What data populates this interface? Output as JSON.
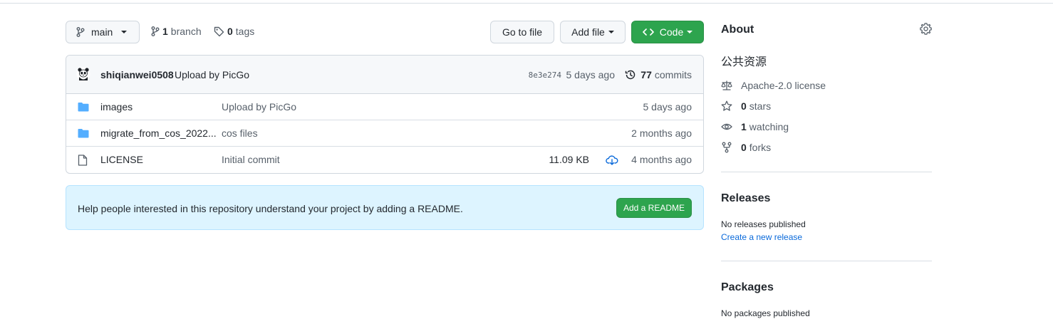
{
  "branch_bar": {
    "branch_name": "main",
    "branch_count": "1",
    "branch_label": "branch",
    "tag_count": "0",
    "tag_label": "tags"
  },
  "actions": {
    "go_to_file": "Go to file",
    "add_file": "Add file",
    "code": "Code"
  },
  "commit": {
    "author": "shiqianwei0508",
    "message": "Upload by PicGo",
    "sha": "8e3e274",
    "time": "5 days ago",
    "count": "77",
    "count_label": "commits"
  },
  "files": [
    {
      "type": "folder",
      "name": "images",
      "message": "Upload by PicGo",
      "size": "",
      "time": "5 days ago"
    },
    {
      "type": "folder",
      "name": "migrate_from_cos_2022...",
      "message": "cos files",
      "size": "",
      "time": "2 months ago"
    },
    {
      "type": "file",
      "name": "LICENSE",
      "message": "Initial commit",
      "size": "11.09 KB",
      "time": "4 months ago"
    }
  ],
  "readme_banner": {
    "text": "Help people interested in this repository understand your project by adding a README.",
    "button": "Add a README"
  },
  "sidebar": {
    "about_title": "About",
    "description": "公共资源",
    "license": "Apache-2.0 license",
    "stars_count": "0",
    "stars_label": "stars",
    "watching_count": "1",
    "watching_label": "watching",
    "forks_count": "0",
    "forks_label": "forks",
    "releases_title": "Releases",
    "releases_none": "No releases published",
    "releases_link": "Create a new release",
    "packages_title": "Packages",
    "packages_none": "No packages published"
  },
  "colors": {
    "accent_green": "#2da44e",
    "link_blue": "#0969da",
    "folder_blue": "#54aeff",
    "banner_bg": "#ddf4ff"
  }
}
